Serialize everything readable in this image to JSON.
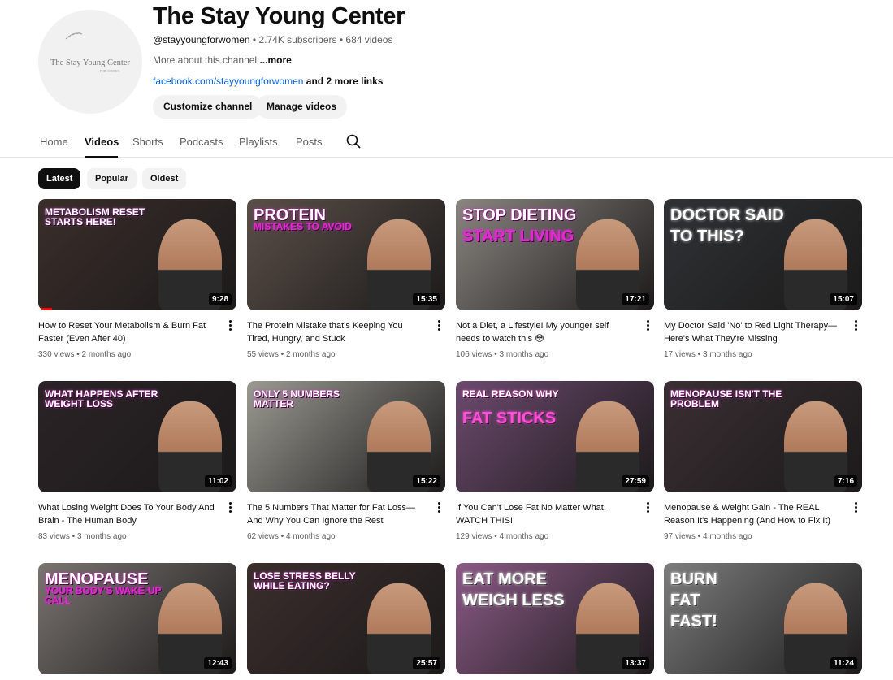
{
  "channel": {
    "avatar_text": "The Stay Young Center",
    "avatar_subtext": "FOR WOMEN",
    "name": "The Stay Young Center",
    "handle": "@stayyoungforwomen",
    "subscribers": "2.74K subscribers",
    "videos_count": "684 videos",
    "about": "More about this channel",
    "about_more": "...more",
    "link": "facebook.com/stayyoungforwomen",
    "more_links": "and 2 more links",
    "customize_label": "Customize channel",
    "manage_label": "Manage videos"
  },
  "tabs": [
    {
      "label": "Home"
    },
    {
      "label": "Videos",
      "active": true
    },
    {
      "label": "Shorts"
    },
    {
      "label": "Podcasts"
    },
    {
      "label": "Playlists"
    },
    {
      "label": "Posts"
    }
  ],
  "filters": [
    {
      "label": "Latest",
      "active": true
    },
    {
      "label": "Popular"
    },
    {
      "label": "Oldest"
    }
  ],
  "videos": [
    {
      "title": "How to Reset Your Metabolism & Burn Fat Faster (Even After 40)",
      "views": "330 views",
      "age": "2 months ago",
      "duration": "9:28",
      "overlay": "Metabolism Reset Starts Here!",
      "watched": 0.07,
      "bg": "#3a2e2a",
      "accent": "#c03fc0"
    },
    {
      "title": "The Protein Mistake that's Keeping You Tired, Hungry, and Stuck",
      "views": "55 views",
      "age": "2 months ago",
      "duration": "15:35",
      "overlay": "Protein",
      "overlay2": "Mistakes to Avoid",
      "bg": "#5a4f48",
      "accent": "#e02bd0"
    },
    {
      "title": "Not a Diet, a Lifestyle! My younger self needs to watch this 😳",
      "views": "106 views",
      "age": "3 months ago",
      "duration": "17:21",
      "overlay": "Stop Dieting",
      "overlay2": "Start Living",
      "bg": "#8a8580",
      "accent": "#e02bd0"
    },
    {
      "title": "My Doctor Said 'No' to Red Light Therapy—Here's What They're Missing",
      "views": "17 views",
      "age": "3 months ago",
      "duration": "15:07",
      "overlay": "Doctor Said",
      "overlay2": "To This?",
      "bg": "#2f3235",
      "accent": "#ffffff"
    },
    {
      "title": "What Losing Weight Does To Your Body And Brain - The Human Body",
      "views": "83 views",
      "age": "3 months ago",
      "duration": "11:02",
      "overlay": "What Happens After Weight Loss",
      "bg": "#2b2327",
      "accent": "#e02bd0"
    },
    {
      "title": "The 5 Numbers That Matter for Fat Loss—And Why You Can Ignore the Rest",
      "views": "62 views",
      "age": "4 months ago",
      "duration": "15:22",
      "overlay": "Only 5 Numbers Matter",
      "bg": "#9a9a92",
      "accent": "#e02bd0"
    },
    {
      "title": "If You Can't Lose Fat No Matter What, WATCH THIS!",
      "views": "129 views",
      "age": "4 months ago",
      "duration": "27:59",
      "overlay": "Real Reason Why",
      "overlay2": "Fat Sticks",
      "bg": "#6c4a6e",
      "accent": "#ff4fd8"
    },
    {
      "title": "Menopause & Weight Gain - The REAL Reason It's Happening (And How to Fix It)",
      "views": "97 views",
      "age": "4 months ago",
      "duration": "7:16",
      "overlay": "Menopause Isn't The Problem",
      "bg": "#3a2f33",
      "accent": "#e02bd0"
    },
    {
      "title": "",
      "views": "",
      "age": "",
      "duration": "12:43",
      "overlay": "Menopause",
      "overlay2": "Your Body's Wake-Up Call",
      "bg": "#7a7470",
      "accent": "#e02bd0"
    },
    {
      "title": "",
      "views": "",
      "age": "",
      "duration": "25:57",
      "overlay": "Lose Stress Belly While Eating?",
      "bg": "#3a2e2c",
      "accent": "#e02bd0"
    },
    {
      "title": "",
      "views": "",
      "age": "",
      "duration": "13:37",
      "overlay": "Eat More",
      "overlay2": "Weigh Less",
      "bg": "#8a5a86",
      "accent": "#ffffff"
    },
    {
      "title": "",
      "views": "",
      "age": "",
      "duration": "11:24",
      "overlay": "Burn",
      "overlay2": "Fat",
      "overlay3": "Fast!",
      "bg": "#7d7d7d",
      "accent": "#ffffff"
    }
  ],
  "colors": {
    "brand_accent": "#e02bd0",
    "link": "#065fd4",
    "progress": "#ff0000"
  },
  "icons": {
    "search": "search-icon",
    "more": "more-vert-icon"
  }
}
